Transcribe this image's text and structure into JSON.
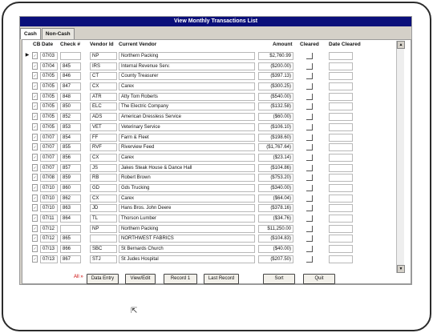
{
  "window": {
    "title": "View Monthly Transactions List"
  },
  "tabs": [
    {
      "label": "Cash"
    },
    {
      "label": "Non-Cash"
    }
  ],
  "columns": {
    "cb": "CB",
    "date": "Date",
    "check": "Check #",
    "vendor_id": "Vendor Id",
    "vendor": "Current Vendor",
    "amount": "Amount",
    "cleared": "Cleared",
    "date_cleared": "Date Cleared"
  },
  "rows": [
    {
      "date": "07/03",
      "check": "",
      "vid": "NP",
      "vendor": "Northern Packing",
      "amount": "$2,760.99"
    },
    {
      "date": "07/04",
      "check": "845",
      "vid": "IRS",
      "vendor": "Internal Revenue Serv.",
      "amount": "($200.00)"
    },
    {
      "date": "07/05",
      "check": "846",
      "vid": "CT",
      "vendor": "County Treasurer",
      "amount": "($397.13)"
    },
    {
      "date": "07/05",
      "check": "847",
      "vid": "CX",
      "vendor": "Carex",
      "amount": "($300.25)"
    },
    {
      "date": "07/05",
      "check": "848",
      "vid": "ATR",
      "vendor": "Atty Tom Roberts",
      "amount": "($540.00)"
    },
    {
      "date": "07/05",
      "check": "850",
      "vid": "ELC",
      "vendor": "The Electric Company",
      "amount": "($132.58)"
    },
    {
      "date": "07/05",
      "check": "852",
      "vid": "ADS",
      "vendor": "American Dressless Service",
      "amount": "($60.00)"
    },
    {
      "date": "07/05",
      "check": "853",
      "vid": "VET",
      "vendor": "Veterinary Service",
      "amount": "($106.10)"
    },
    {
      "date": "07/07",
      "check": "854",
      "vid": "FF",
      "vendor": "Farm & Fleet",
      "amount": "($198.60)"
    },
    {
      "date": "07/07",
      "check": "855",
      "vid": "RVF",
      "vendor": "Riverview Feed",
      "amount": "($1,767.64)"
    },
    {
      "date": "07/07",
      "check": "856",
      "vid": "CX",
      "vendor": "Carex",
      "amount": "($23.14)"
    },
    {
      "date": "07/07",
      "check": "857",
      "vid": "JS",
      "vendor": "Jakes Steak House & Dance Hall",
      "amount": "($104.86)"
    },
    {
      "date": "07/08",
      "check": "859",
      "vid": "RB",
      "vendor": "Robert Brown",
      "amount": "($753.20)"
    },
    {
      "date": "07/10",
      "check": "860",
      "vid": "GD",
      "vendor": "Gds Trucking",
      "amount": "($340.00)"
    },
    {
      "date": "07/10",
      "check": "862",
      "vid": "CX",
      "vendor": "Carex",
      "amount": "($64.04)"
    },
    {
      "date": "07/10",
      "check": "863",
      "vid": "JD",
      "vendor": "Hans Bros. John Deere",
      "amount": "($378.16)"
    },
    {
      "date": "07/11",
      "check": "864",
      "vid": "TL",
      "vendor": "Thorson Lumber",
      "amount": "($34.76)"
    },
    {
      "date": "07/12",
      "check": "",
      "vid": "NP",
      "vendor": "Northern Packing",
      "amount": "$11,250.00"
    },
    {
      "date": "07/12",
      "check": "865",
      "vid": "",
      "vendor": "NORTHWEST FABRICS",
      "amount": "($104.83)"
    },
    {
      "date": "07/13",
      "check": "866",
      "vid": "SBC",
      "vendor": "St Bernards Church",
      "amount": "($40.00)"
    },
    {
      "date": "07/13",
      "check": "867",
      "vid": "STJ",
      "vendor": "St Judes Hospital",
      "amount": "($207.50)"
    }
  ],
  "footer": {
    "all_label": "All »",
    "buttons": [
      "Data Entry",
      "View/Edit",
      "Record 1",
      "Last Record",
      "Sort",
      "Quit"
    ]
  }
}
